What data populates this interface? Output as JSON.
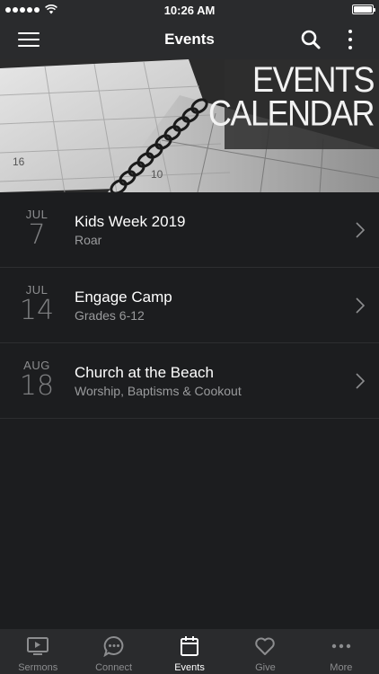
{
  "status_bar": {
    "time": "10:26 AM"
  },
  "nav": {
    "title": "Events"
  },
  "banner": {
    "line1": "EVENTS",
    "line2": "CALENDAR",
    "calendar_numbers": [
      "16",
      "10"
    ]
  },
  "events": [
    {
      "month": "JUL",
      "day": "7",
      "title": "Kids Week 2019",
      "subtitle": "Roar"
    },
    {
      "month": "JUL",
      "day": "14",
      "title": "Engage Camp",
      "subtitle": "Grades 6-12"
    },
    {
      "month": "AUG",
      "day": "18",
      "title": "Church at the Beach",
      "subtitle": "Worship, Baptisms & Cookout"
    }
  ],
  "tabs": [
    {
      "label": "Sermons",
      "icon": "tv-icon",
      "active": false
    },
    {
      "label": "Connect",
      "icon": "chat-bubble-icon",
      "active": false
    },
    {
      "label": "Events",
      "icon": "calendar-icon",
      "active": true
    },
    {
      "label": "Give",
      "icon": "heart-icon",
      "active": false
    },
    {
      "label": "More",
      "icon": "ellipsis-icon",
      "active": false
    }
  ],
  "colors": {
    "background": "#1c1d1f",
    "bar": "#2a2b2d",
    "muted_text": "#8c8d8f",
    "divider": "#2d2e30"
  }
}
